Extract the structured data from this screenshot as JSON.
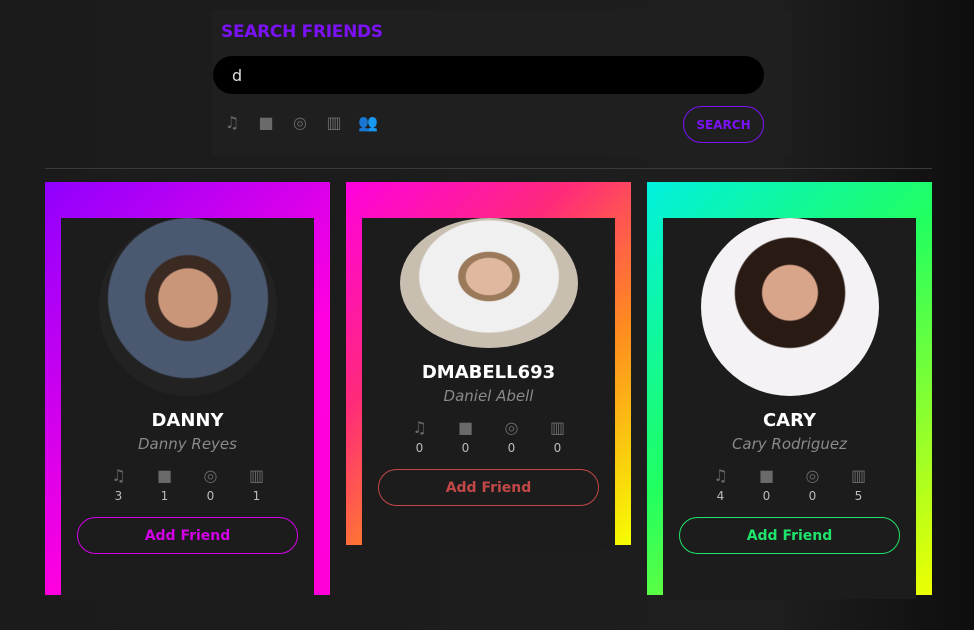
{
  "search": {
    "title": "SEARCH FRIENDS",
    "value": "d",
    "button": "SEARCH",
    "filter_icons": [
      "music-icon",
      "video-icon",
      "gamepad-icon",
      "book-icon",
      "users-icon"
    ]
  },
  "cards": [
    {
      "username": "DANNY",
      "fullname": "Danny Reyes",
      "stats": {
        "music": "3",
        "video": "1",
        "games": "0",
        "books": "1"
      },
      "button": "Add Friend",
      "accent": "#d400e8"
    },
    {
      "username": "DMABELL693",
      "fullname": "Daniel Abell",
      "stats": {
        "music": "0",
        "video": "0",
        "games": "0",
        "books": "0"
      },
      "button": "Add Friend",
      "accent": "#c24848"
    },
    {
      "username": "CARY",
      "fullname": "Cary Rodriguez",
      "stats": {
        "music": "4",
        "video": "0",
        "games": "0",
        "books": "5"
      },
      "button": "Add Friend",
      "accent": "#1fe36a"
    }
  ]
}
